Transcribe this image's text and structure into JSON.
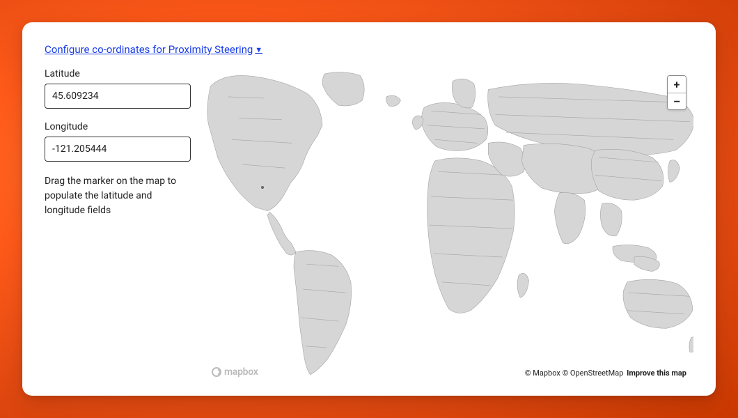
{
  "header": {
    "link_text": "Configure co-ordinates for Proximity Steering"
  },
  "form": {
    "latitude_label": "Latitude",
    "latitude_value": "45.609234",
    "longitude_label": "Longitude",
    "longitude_value": "-121.205444",
    "help_text": "Drag the marker on the map to populate the latitude and longitude fields"
  },
  "map": {
    "zoom_in": "+",
    "zoom_out": "–",
    "attribution_mapbox": "© Mapbox",
    "attribution_osm": "© OpenStreetMap",
    "improve_link": "Improve this map",
    "logo_text": "mapbox"
  }
}
